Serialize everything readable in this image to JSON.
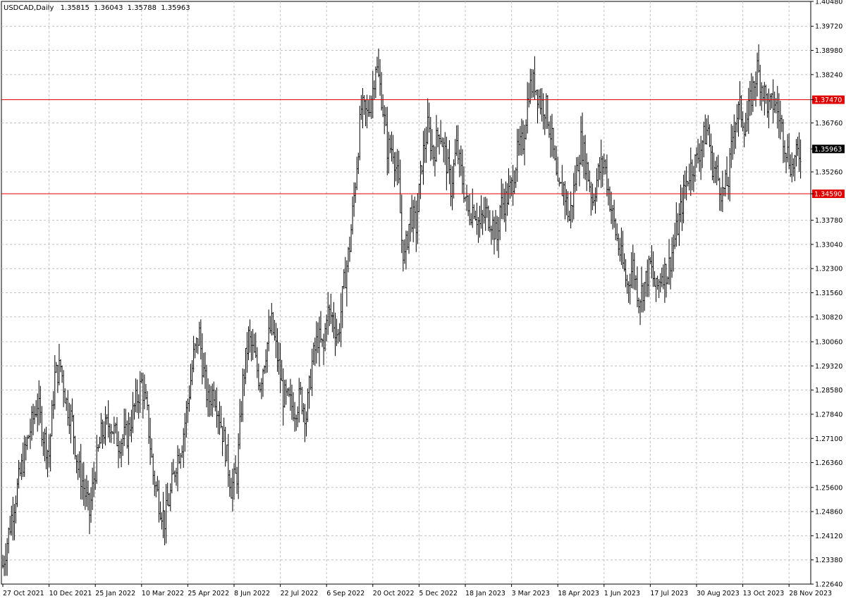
{
  "chart_data": {
    "type": "ohlc_bar",
    "symbol_title": "USDCAD,Daily",
    "ohlc_values": [
      "1.35815",
      "1.36043",
      "1.35788",
      "1.35963"
    ],
    "ylim": [
      1.2264,
      1.4048
    ],
    "y_ticks": [
      "1.40480",
      "1.39720",
      "1.38980",
      "1.38240",
      "1.37470",
      "1.36760",
      "1.35963",
      "1.35260",
      "1.34590",
      "1.33780",
      "1.33040",
      "1.32300",
      "1.31560",
      "1.30820",
      "1.30060",
      "1.29320",
      "1.28580",
      "1.27840",
      "1.27100",
      "1.26360",
      "1.25600",
      "1.24860",
      "1.24120",
      "1.23380",
      "1.22640"
    ],
    "y_tick_values": [
      1.4048,
      1.3972,
      1.3898,
      1.3824,
      1.3747,
      1.3676,
      1.35963,
      1.3526,
      1.3459,
      1.3378,
      1.3304,
      1.323,
      1.3156,
      1.3082,
      1.3006,
      1.2932,
      1.2858,
      1.2784,
      1.271,
      1.2636,
      1.256,
      1.2486,
      1.2412,
      1.2338,
      1.2264
    ],
    "x_ticks": [
      "27 Oct 2021",
      "10 Dec 2021",
      "25 Jan 2022",
      "10 Mar 2022",
      "25 Apr 2022",
      "8 Jun 2022",
      "22 Jul 2022",
      "6 Sep 2022",
      "20 Oct 2022",
      "5 Dec 2022",
      "18 Jan 2023",
      "3 Mar 2023",
      "18 Apr 2023",
      "1 Jun 2023",
      "17 Jul 2023",
      "30 Aug 2023",
      "13 Oct 2023",
      "28 Nov 2023"
    ],
    "x_tick_bar_index": [
      0,
      32,
      64,
      96,
      128,
      160,
      192,
      224,
      256,
      288,
      320,
      352,
      384,
      416,
      448,
      480,
      512,
      544
    ],
    "horizontal_lines": [
      {
        "value": 1.3747,
        "label": "1.37470",
        "color": "#e00000"
      },
      {
        "value": 1.3459,
        "label": "1.34590",
        "color": "#e00000"
      }
    ],
    "current_price": {
      "value": 1.35963,
      "label": "1.35963"
    },
    "grid": true,
    "bar_color": "#000000",
    "close_path": [
      [
        0,
        1.232
      ],
      [
        6,
        1.247
      ],
      [
        12,
        1.26
      ],
      [
        18,
        1.272
      ],
      [
        24,
        1.282
      ],
      [
        28,
        1.272
      ],
      [
        32,
        1.266
      ],
      [
        36,
        1.29
      ],
      [
        40,
        1.293
      ],
      [
        44,
        1.282
      ],
      [
        48,
        1.276
      ],
      [
        52,
        1.262
      ],
      [
        55,
        1.258
      ],
      [
        60,
        1.248
      ],
      [
        63,
        1.259
      ],
      [
        68,
        1.272
      ],
      [
        74,
        1.276
      ],
      [
        80,
        1.27
      ],
      [
        86,
        1.272
      ],
      [
        92,
        1.282
      ],
      [
        96,
        1.288
      ],
      [
        100,
        1.278
      ],
      [
        104,
        1.26
      ],
      [
        108,
        1.252
      ],
      [
        112,
        1.246
      ],
      [
        116,
        1.254
      ],
      [
        120,
        1.264
      ],
      [
        124,
        1.27
      ],
      [
        128,
        1.282
      ],
      [
        132,
        1.296
      ],
      [
        136,
        1.303
      ],
      [
        138,
        1.294
      ],
      [
        142,
        1.282
      ],
      [
        146,
        1.286
      ],
      [
        150,
        1.278
      ],
      [
        154,
        1.268
      ],
      [
        158,
        1.256
      ],
      [
        162,
        1.26
      ],
      [
        166,
        1.288
      ],
      [
        170,
        1.302
      ],
      [
        174,
        1.296
      ],
      [
        178,
        1.288
      ],
      [
        182,
        1.298
      ],
      [
        186,
        1.306
      ],
      [
        190,
        1.296
      ],
      [
        194,
        1.284
      ],
      [
        198,
        1.282
      ],
      [
        202,
        1.28
      ],
      [
        206,
        1.284
      ],
      [
        210,
        1.278
      ],
      [
        214,
        1.294
      ],
      [
        218,
        1.302
      ],
      [
        222,
        1.298
      ],
      [
        224,
        1.31
      ],
      [
        228,
        1.308
      ],
      [
        232,
        1.302
      ],
      [
        236,
        1.318
      ],
      [
        240,
        1.33
      ],
      [
        244,
        1.35
      ],
      [
        248,
        1.372
      ],
      [
        252,
        1.37
      ],
      [
        256,
        1.378
      ],
      [
        258,
        1.386
      ],
      [
        262,
        1.376
      ],
      [
        266,
        1.36
      ],
      [
        270,
        1.36
      ],
      [
        274,
        1.348
      ],
      [
        276,
        1.332
      ],
      [
        278,
        1.326
      ],
      [
        282,
        1.34
      ],
      [
        286,
        1.336
      ],
      [
        290,
        1.356
      ],
      [
        294,
        1.366
      ],
      [
        298,
        1.358
      ],
      [
        302,
        1.366
      ],
      [
        306,
        1.358
      ],
      [
        310,
        1.348
      ],
      [
        314,
        1.36
      ],
      [
        318,
        1.35
      ],
      [
        322,
        1.34
      ],
      [
        326,
        1.342
      ],
      [
        330,
        1.336
      ],
      [
        334,
        1.34
      ],
      [
        338,
        1.338
      ],
      [
        342,
        1.332
      ],
      [
        344,
        1.342
      ],
      [
        348,
        1.344
      ],
      [
        352,
        1.348
      ],
      [
        356,
        1.358
      ],
      [
        360,
        1.362
      ],
      [
        364,
        1.378
      ],
      [
        368,
        1.38
      ],
      [
        372,
        1.374
      ],
      [
        376,
        1.372
      ],
      [
        380,
        1.362
      ],
      [
        384,
        1.346
      ],
      [
        388,
        1.348
      ],
      [
        392,
        1.338
      ],
      [
        396,
        1.35
      ],
      [
        400,
        1.362
      ],
      [
        404,
        1.354
      ],
      [
        408,
        1.344
      ],
      [
        412,
        1.352
      ],
      [
        416,
        1.356
      ],
      [
        420,
        1.344
      ],
      [
        424,
        1.334
      ],
      [
        428,
        1.326
      ],
      [
        432,
        1.318
      ],
      [
        436,
        1.324
      ],
      [
        440,
        1.314
      ],
      [
        444,
        1.318
      ],
      [
        448,
        1.324
      ],
      [
        452,
        1.316
      ],
      [
        456,
        1.322
      ],
      [
        460,
        1.322
      ],
      [
        464,
        1.33
      ],
      [
        468,
        1.338
      ],
      [
        472,
        1.348
      ],
      [
        476,
        1.354
      ],
      [
        480,
        1.356
      ],
      [
        484,
        1.362
      ],
      [
        488,
        1.366
      ],
      [
        490,
        1.356
      ],
      [
        494,
        1.352
      ],
      [
        498,
        1.346
      ],
      [
        502,
        1.35
      ],
      [
        506,
        1.368
      ],
      [
        510,
        1.372
      ],
      [
        514,
        1.366
      ],
      [
        518,
        1.376
      ],
      [
        522,
        1.384
      ],
      [
        526,
        1.378
      ],
      [
        530,
        1.372
      ],
      [
        534,
        1.374
      ],
      [
        538,
        1.368
      ],
      [
        542,
        1.36
      ],
      [
        546,
        1.354
      ],
      [
        550,
        1.358
      ],
      [
        552,
        1.359
      ]
    ]
  }
}
